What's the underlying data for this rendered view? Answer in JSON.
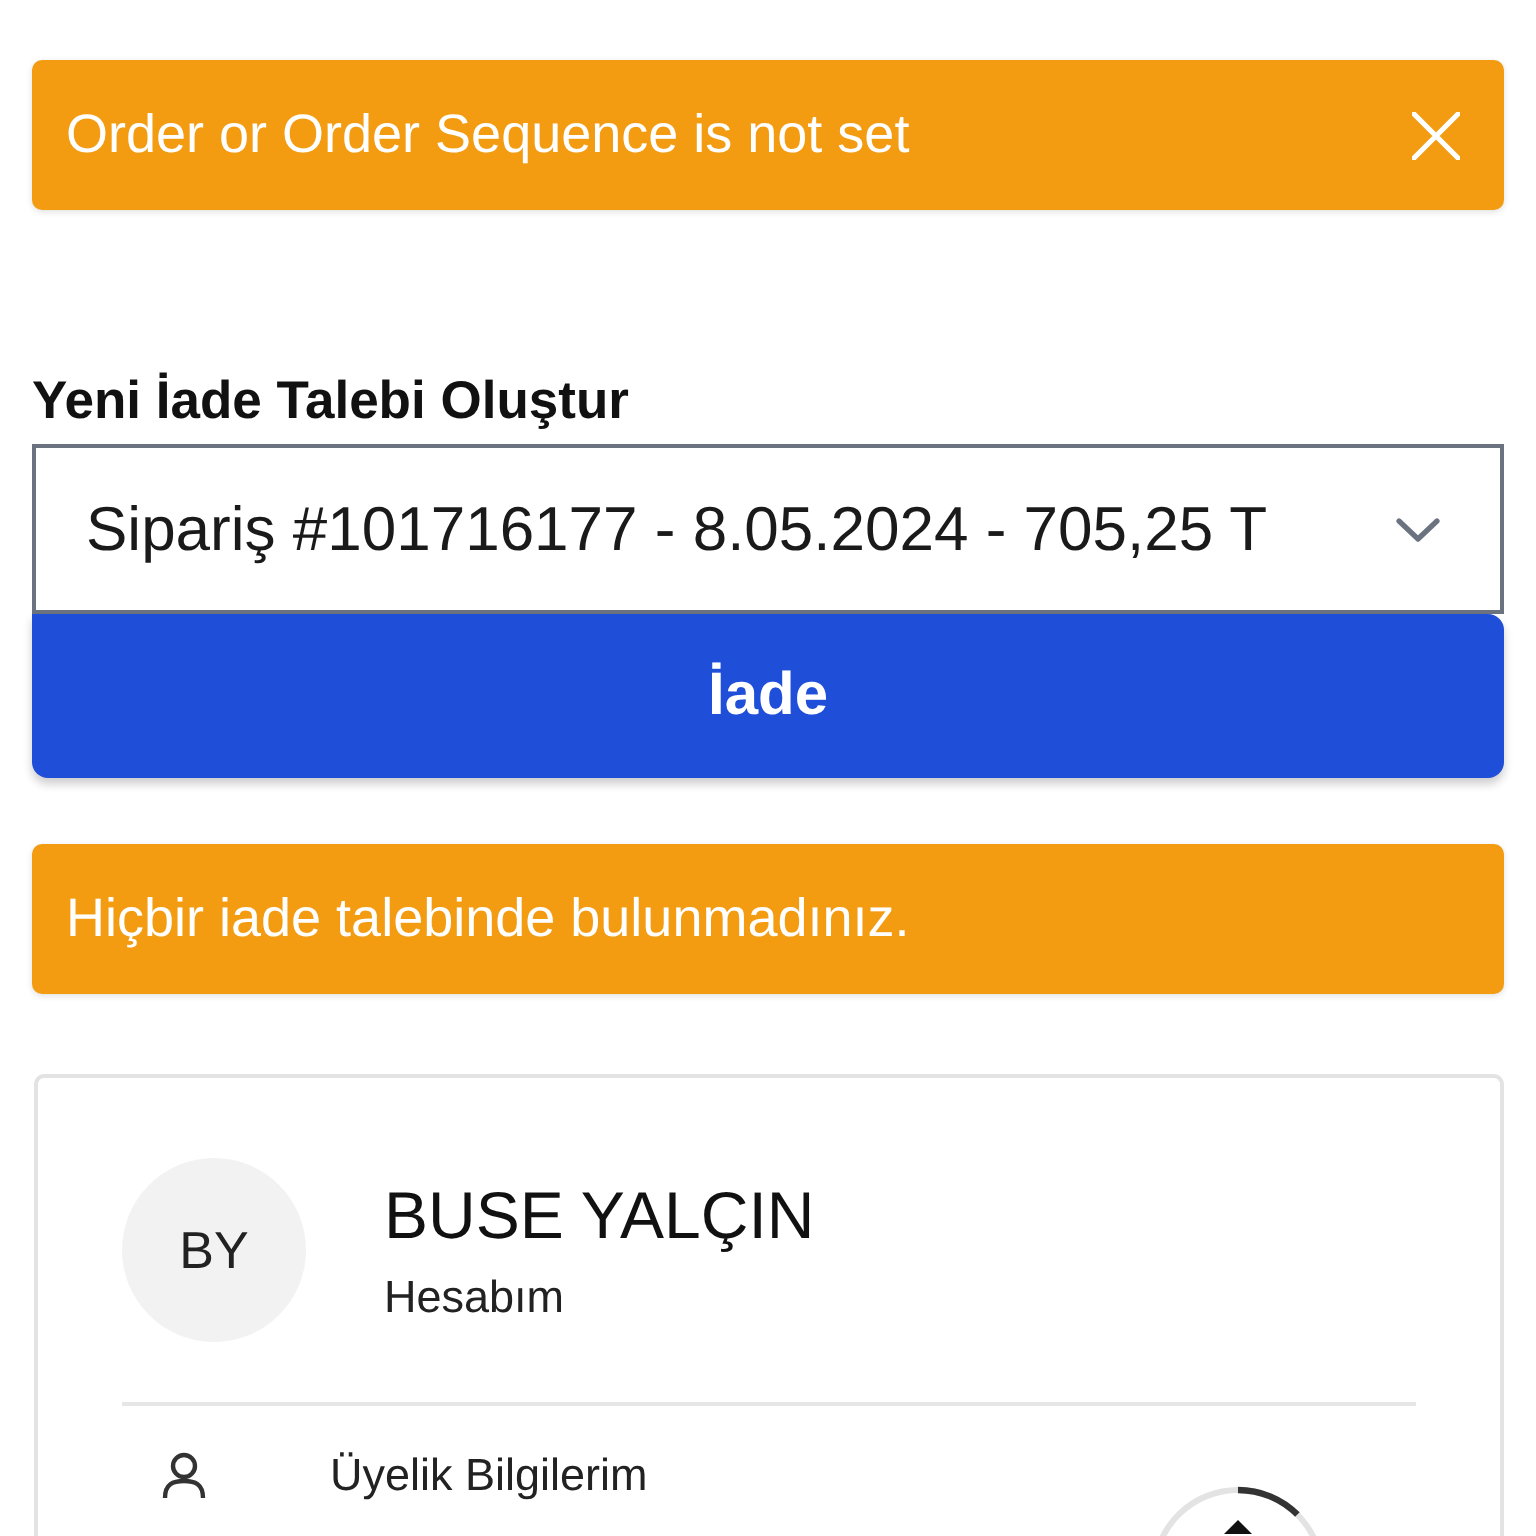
{
  "top_alert": {
    "text": "Order or Order Sequence is not set",
    "dismissible": true
  },
  "return_form": {
    "heading": "Yeni İade Talebi Oluştur",
    "order_select": {
      "value": "Sipariş #101716177 - 8.05.2024 - 705,25 T"
    },
    "submit_button": "İade"
  },
  "info_alert": {
    "text": "Hiçbir iade talebinde bulunmadınız.",
    "dismissible": false
  },
  "account_card": {
    "avatar_initials": "BY",
    "name": "BUSE YALÇIN",
    "subtitle": "Hesabım",
    "menu_items": [
      {
        "label": "Üyelik Bilgilerim"
      }
    ]
  }
}
